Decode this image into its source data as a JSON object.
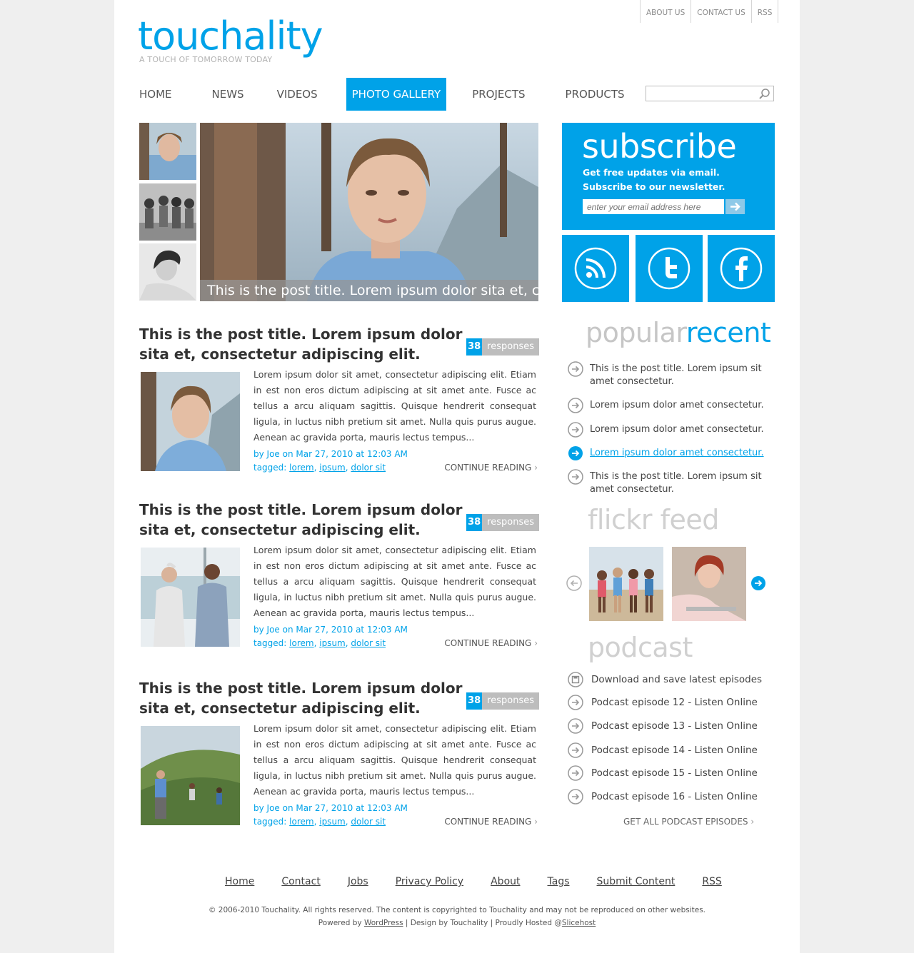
{
  "site": {
    "logo": "touchality",
    "tagline": "A TOUCH OF TOMORROW TODAY",
    "accent": "#00a2e8"
  },
  "toplinks": [
    "ABOUT US",
    "CONTACT US",
    "RSS"
  ],
  "nav": {
    "items": [
      "HOME",
      "NEWS",
      "VIDEOS",
      "PHOTO GALLERY",
      "PROJECTS",
      "PRODUCTS"
    ],
    "active": "PHOTO GALLERY"
  },
  "search": {
    "placeholder": "",
    "icon": "search-icon"
  },
  "featured": {
    "caption": "This is the post title. Lorem ipsum dolor sita et, consectetur adipiscing elit."
  },
  "posts": [
    {
      "title": "This is the post title. Lorem ipsum dolor sita et, consectetur adipiscing elit.",
      "responses_count": "38",
      "responses_label": "responses",
      "excerpt": "Lorem ipsum dolor sit amet, consectetur adipiscing elit. Etiam in est non eros dictum adipiscing at sit amet ante. Fusce ac tellus a arcu aliquam sagittis. Quisque hendrerit consequat ligula, in luctus nibh pretium sit amet. Nulla quis purus augue. Aenean ac gravida porta, mauris lectus tempus...",
      "byline": "by Joe on Mar 27, 2010 at 12:03 AM",
      "tagged_label": "tagged:",
      "tags": [
        "lorem",
        "ipsum",
        "dolor sit"
      ],
      "continue": "CONTINUE READING"
    },
    {
      "title": "This is the post title. Lorem ipsum dolor sita et, consectetur adipiscing elit.",
      "responses_count": "38",
      "responses_label": "responses",
      "excerpt": "Lorem ipsum dolor sit amet, consectetur adipiscing elit. Etiam in est non eros dictum adipiscing at sit amet ante. Fusce ac tellus a arcu aliquam sagittis. Quisque hendrerit consequat ligula, in luctus nibh pretium sit amet. Nulla quis purus augue. Aenean ac gravida porta, mauris lectus tempus...",
      "byline": "by Joe on Mar 27, 2010 at 12:03 AM",
      "tagged_label": "tagged:",
      "tags": [
        "lorem",
        "ipsum",
        "dolor sit"
      ],
      "continue": "CONTINUE READING"
    },
    {
      "title": "This is the post title. Lorem ipsum dolor sita et, consectetur adipiscing elit.",
      "responses_count": "38",
      "responses_label": "responses",
      "excerpt": "Lorem ipsum dolor sit amet, consectetur adipiscing elit. Etiam in est non eros dictum adipiscing at sit amet ante. Fusce ac tellus a arcu aliquam sagittis. Quisque hendrerit consequat ligula, in luctus nibh pretium sit amet. Nulla quis purus augue. Aenean ac gravida porta, mauris lectus tempus...",
      "byline": "by Joe on Mar 27, 2010 at 12:03 AM",
      "tagged_label": "tagged:",
      "tags": [
        "lorem",
        "ipsum",
        "dolor sit"
      ],
      "continue": "CONTINUE READING"
    }
  ],
  "subscribe": {
    "title": "subscribe",
    "text": "Get free updates via email. Subscribe to our newsletter.",
    "placeholder": "enter your email address here"
  },
  "social": [
    "rss-icon",
    "twitter-icon",
    "facebook-icon"
  ],
  "sidebar_tabs": {
    "popular": "popular",
    "recent": "recent",
    "active": "recent"
  },
  "recent_items": [
    {
      "text": "This is the post title. Lorem ipsum sit amet consectetur.",
      "active": false
    },
    {
      "text": "Lorem ipsum dolor amet consectetur.",
      "active": false
    },
    {
      "text": "Lorem ipsum dolor amet consectetur.",
      "active": false
    },
    {
      "text": "Lorem ipsum dolor amet consectetur.",
      "active": true
    },
    {
      "text": "This is the post title. Lorem ipsum sit amet consectetur.",
      "active": false
    }
  ],
  "flickr": {
    "title": "flickr feed"
  },
  "podcast": {
    "title": "podcast",
    "items": [
      {
        "text": "Download and save latest episodes",
        "icon": "save-icon"
      },
      {
        "text": "Podcast episode 12 - Listen Online",
        "icon": "arrow-right-icon"
      },
      {
        "text": "Podcast episode 13 - Listen Online",
        "icon": "arrow-right-icon"
      },
      {
        "text": "Podcast episode 14 - Listen Online",
        "icon": "arrow-right-icon"
      },
      {
        "text": "Podcast episode 15 - Listen Online",
        "icon": "arrow-right-icon"
      },
      {
        "text": "Podcast episode 16 - Listen Online",
        "icon": "arrow-right-icon"
      }
    ],
    "get_all": "GET ALL PODCAST EPISODES"
  },
  "footer": {
    "links": [
      "Home",
      "Contact",
      "Jobs",
      "Privacy Policy",
      "About",
      "Tags",
      "Submit Content",
      "RSS"
    ],
    "copyright": "© 2006-2010 Touchality. All rights reserved. The content is copyrighted to Touchality and may not be reproduced on other websites.",
    "powered_prefix": "Powered by",
    "powered_link": "WordPress",
    "design_text": "| Design by Touchality | Proudly Hosted @",
    "host_link": "Slicehost"
  }
}
